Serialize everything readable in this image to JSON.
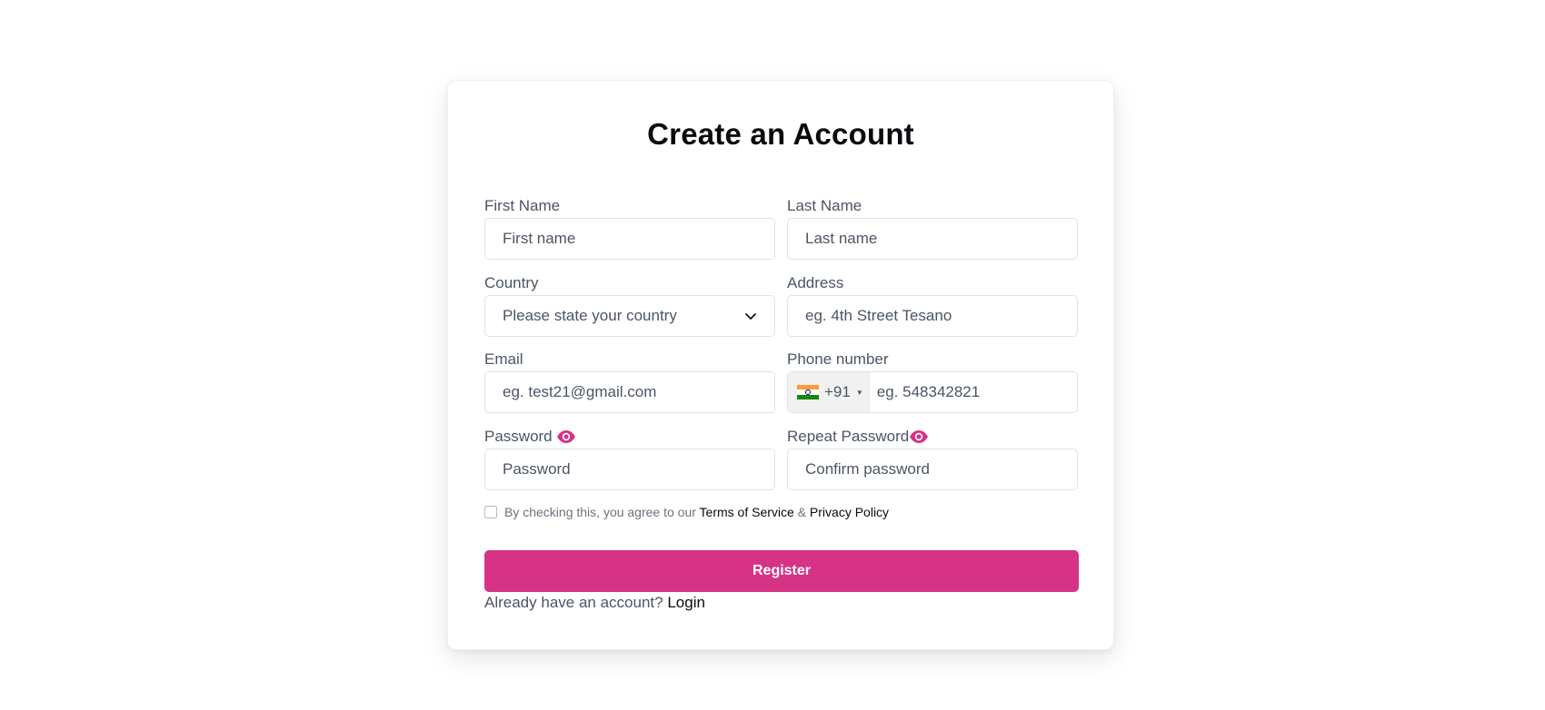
{
  "form": {
    "title": "Create an Account",
    "first_name": {
      "label": "First Name",
      "placeholder": "First name"
    },
    "last_name": {
      "label": "Last Name",
      "placeholder": "Last name"
    },
    "country": {
      "label": "Country",
      "selected": "Please state your country",
      "icon": "chevron-down-icon"
    },
    "address": {
      "label": "Address",
      "placeholder": "eg. 4th Street Tesano"
    },
    "email": {
      "label": "Email",
      "placeholder": "eg. test21@gmail.com"
    },
    "phone": {
      "label": "Phone number",
      "dial_code": "+91",
      "flag": "india-flag-icon",
      "placeholder": "eg. 548342821"
    },
    "password": {
      "label": "Password",
      "placeholder": "Password",
      "icon": "eye-icon"
    },
    "repeat_password": {
      "label": "Repeat Password",
      "placeholder": "Confirm password",
      "icon": "eye-icon"
    },
    "terms": {
      "prefix": "By checking this, you agree to our",
      "terms_link": "Terms of Service",
      "amp": "&",
      "privacy_link": "Privacy Policy"
    },
    "register_label": "Register",
    "login_prompt": "Already have an account?",
    "login_link": "Login"
  },
  "colors": {
    "accent": "#d63384",
    "eye_icon": "#d63384"
  }
}
